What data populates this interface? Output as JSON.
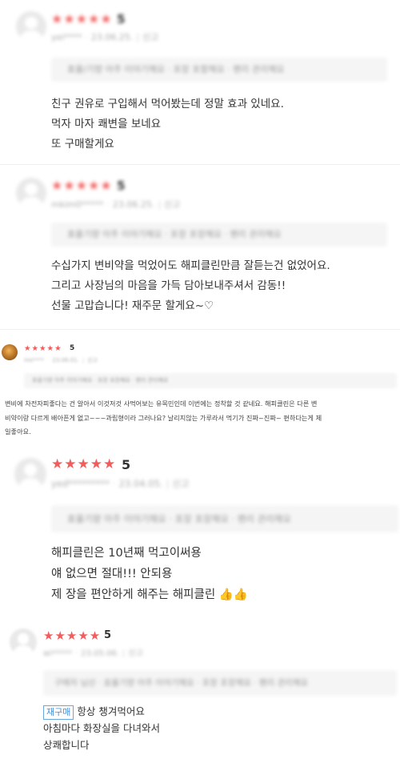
{
  "reviews": [
    {
      "stars": "★★★★★",
      "score": "5",
      "user": "yei****",
      "date": "23.06.25.",
      "report": "신고",
      "tags": "효율/기량 아주 이야기해요 · 포장 포함해요 · 팬리 관리해요",
      "body": [
        "친구 권유로 구입해서 먹어봤는데 정말 효과 있네요.",
        "먹자 마자 쾌변을 보네요",
        "또 구매할게요"
      ]
    },
    {
      "stars": "★★★★★",
      "score": "5",
      "user": "mkim0*****",
      "date": "23.06.25.",
      "report": "신고",
      "tags": "효율기량 아주 이야기해요 · 포장 포장해요 · 팬리 관리해요",
      "body": [
        "수십가지 변비약을 먹었어도 해피클린만큼 잘듣는건 없었어요.",
        "그리고 사장님의 마음을 가득 담아보내주셔서 감동!!",
        "선물 고맙습니다! 재주문 할게요~♡"
      ]
    },
    {
      "stars": "★★★★★",
      "score": "5",
      "user": "me****",
      "date": "23.06.01.",
      "report": "신고",
      "tags": "효율기량 아주 이야기해요 · 포장 포장해요 · 팬리 관리해요",
      "body": [
        "변비에 차전자피좋다는 건 알아서 이것저것 사먹어보는 유목민인데 이번에는 정착할 것 같네요. 해피클린은 다른 변",
        "비약이랑 다르게 배아픈게 없고~~~과립형이라 그러나요? 날리지않는 가루라서 먹기가 진짜~진짜~ 편하다는게  제",
        "일좋아요."
      ]
    },
    {
      "stars": "★★★★★",
      "score": "5",
      "user": "yed*********",
      "date": "23.04.05.",
      "report": "신고",
      "tags": "효율기량 아주 이야기해요 · 포장 포장해요 · 팬리 관리해요",
      "body": [
        "해피클린은 10년째 먹고이써용",
        "얘 없으면 절대!!! 안되용",
        "제 장을 편안하게 해주는 해피클린 👍👍"
      ]
    },
    {
      "stars": "★★★★★",
      "score": "5",
      "user": "wi*****",
      "date": "23.05.06.",
      "report": "신고",
      "tags": "구매자 님산 · 효율기량 아주 이야기해요 · 포장 포장해요 · 팬리 관리해요",
      "rebuy": "재구매",
      "body": [
        "항상 챙겨먹어요",
        "아침마다 화장실을 다녀와서",
        "상쾌합니다"
      ]
    }
  ]
}
